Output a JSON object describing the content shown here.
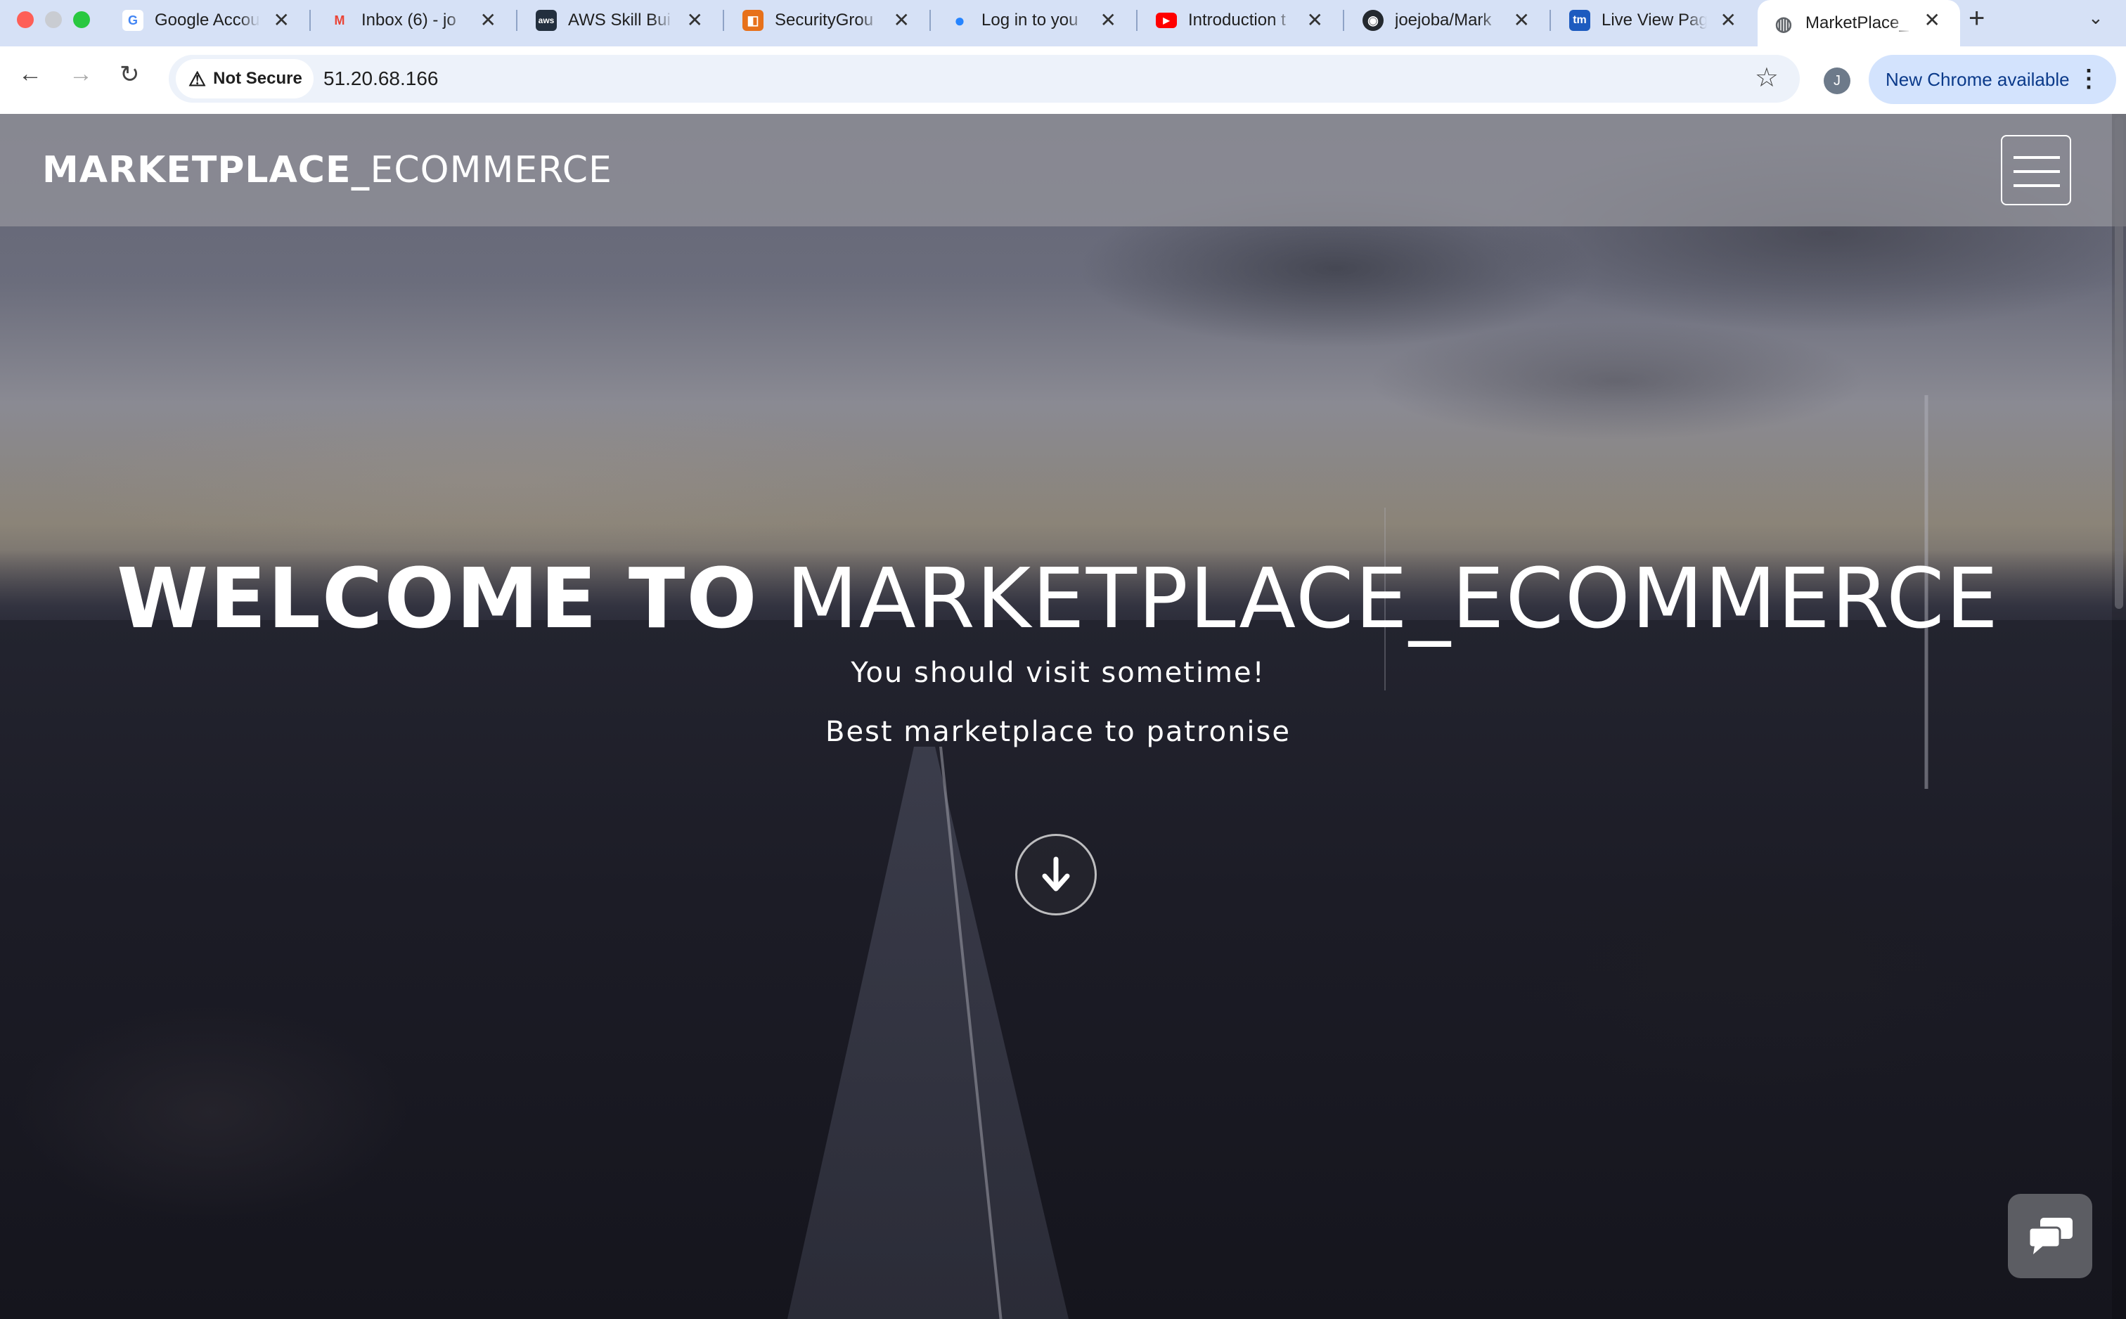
{
  "browser": {
    "tabs": [
      {
        "title": "Google Accou",
        "favicon": "google-icon",
        "color": "#4285f4"
      },
      {
        "title": "Inbox (6) - jo",
        "favicon": "gmail-icon",
        "color": "#ea4335"
      },
      {
        "title": "AWS Skill Bui",
        "favicon": "aws-icon",
        "color": "#232f3e"
      },
      {
        "title": "SecurityGrou",
        "favicon": "aws-ec2-icon",
        "color": "#e7711b"
      },
      {
        "title": "Log in to you",
        "favicon": "jira-icon",
        "color": "#2684ff"
      },
      {
        "title": "Introduction t",
        "favicon": "youtube-icon",
        "color": "#ff0000"
      },
      {
        "title": "joejoba/Mark",
        "favicon": "github-icon",
        "color": "#24292f"
      },
      {
        "title": "Live View Pag",
        "favicon": "tm-icon",
        "color": "#1d5bbf"
      },
      {
        "title": "MarketPlace_",
        "favicon": "globe-icon",
        "color": "#5f6368",
        "active": true
      }
    ],
    "security_label": "Not Secure",
    "url": "51.20.68.166",
    "profile_initial": "J",
    "update_label": "New Chrome available"
  },
  "site": {
    "brand_bold": "MARKETPLACE_",
    "brand_light": "ECOMMERCE",
    "hero": {
      "title_bold": "WELCOME TO",
      "title_light": "MARKETPLACE_ECOMMERCE",
      "subtitle_1": "You should visit sometime!",
      "subtitle_2": "Best marketplace to patronise"
    }
  }
}
